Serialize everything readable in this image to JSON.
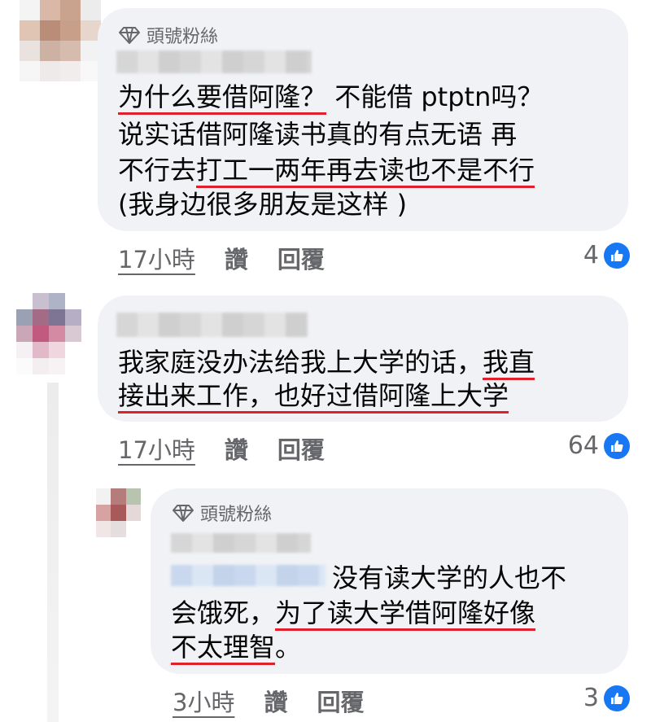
{
  "comments": [
    {
      "badge": "頭號粉絲",
      "lines": [
        [
          {
            "t": "为什么要借阿隆？",
            "u": true
          },
          {
            "t": " 不能借 ptptn吗？",
            "u": false
          }
        ],
        [
          {
            "t": "说实话借阿隆读书真的有点无语 再",
            "u": false
          }
        ],
        [
          {
            "t": "不行去",
            "u": false
          },
          {
            "t": "打工一两年再去读也不是不行",
            "u": true
          }
        ],
        [
          {
            "t": "(我身边很多朋友是这样 )",
            "u": false
          }
        ]
      ],
      "time": "17小時",
      "like_label": "讚",
      "reply_label": "回覆",
      "reaction_count": "4"
    },
    {
      "badge": "",
      "lines": [
        [
          {
            "t": "我家庭没办法给我上大学的话，",
            "u": false
          },
          {
            "t": "我直",
            "u": true
          }
        ],
        [
          {
            "t": "接出来工作，也好过借阿隆上大学",
            "u": true
          }
        ]
      ],
      "time": "17小時",
      "like_label": "讚",
      "reply_label": "回覆",
      "reaction_count": "64"
    },
    {
      "badge": "頭號粉絲",
      "lines": [
        [
          {
            "t": "没有读大学的人也不",
            "u": false
          }
        ],
        [
          {
            "t": "会饿死，",
            "u": false
          },
          {
            "t": "为了读大学借阿隆好像",
            "u": true
          }
        ],
        [
          {
            "t": "不太理智",
            "u": true
          },
          {
            "t": "。",
            "u": false
          }
        ]
      ],
      "time": "3小時",
      "like_label": "讚",
      "reply_label": "回覆",
      "reaction_count": "3"
    }
  ],
  "icons": {
    "badge": "diamond-icon",
    "reaction": "like-thumbs-up-icon"
  },
  "colors": {
    "bubble": "#f0f2f5",
    "meta_text": "#65676b",
    "underline": "#e0202b",
    "like_blue": "#1877f2"
  }
}
